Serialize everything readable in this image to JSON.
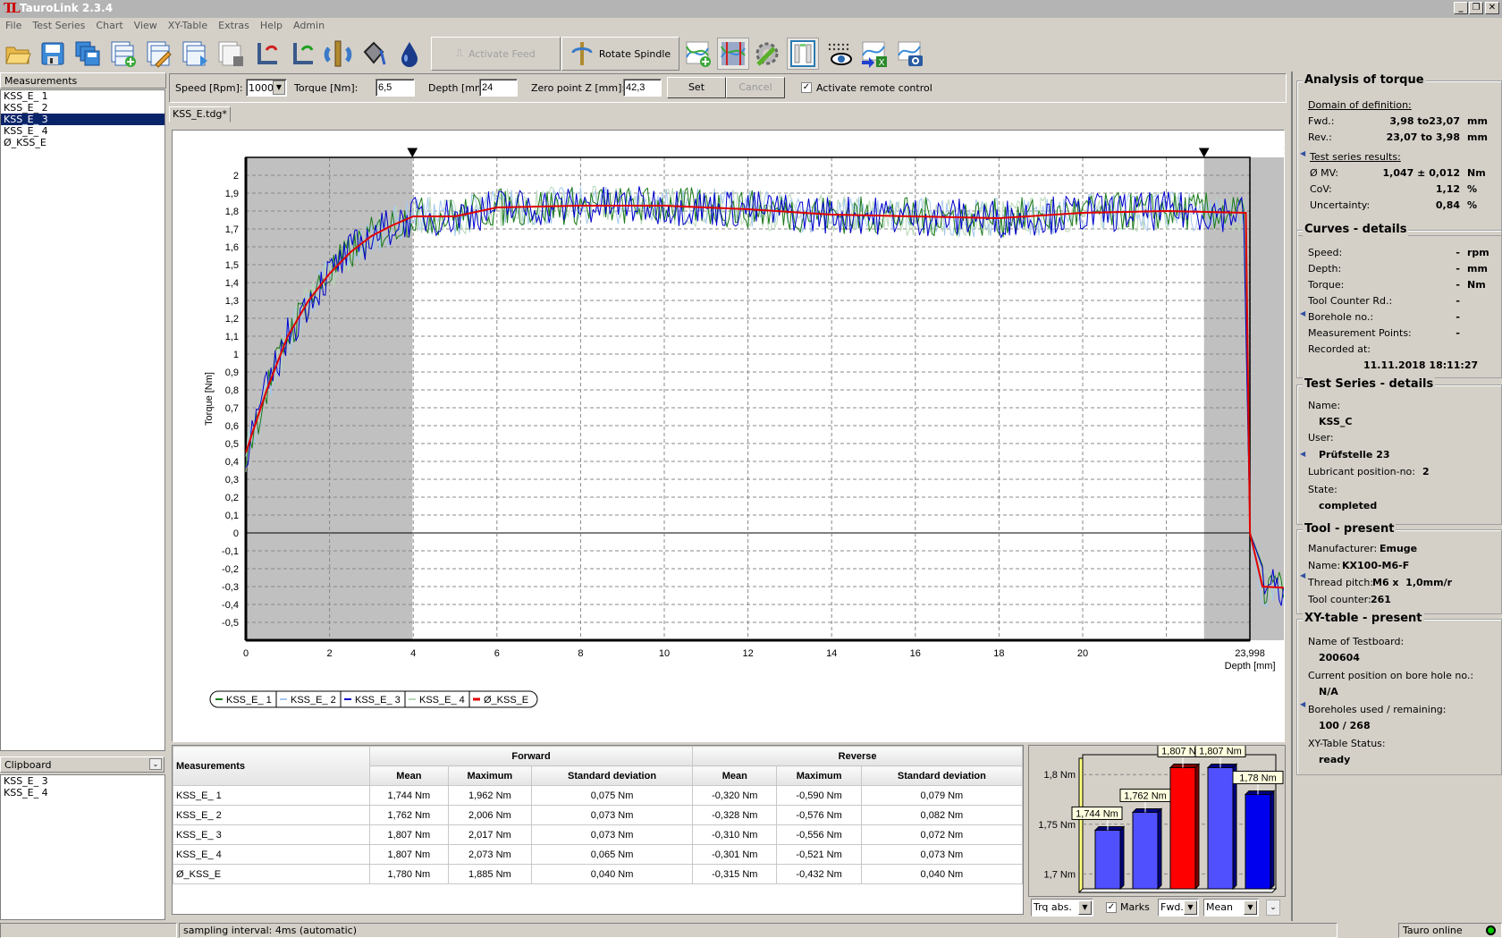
{
  "window": {
    "title": "TauroLink 2.3.4",
    "logo": "TL",
    "controls": [
      "minimize",
      "restore",
      "close"
    ]
  },
  "menu": [
    "File",
    "Test Series",
    "Chart",
    "View",
    "XY-Table",
    "Extras",
    "Help",
    "Admin"
  ],
  "toolbar": {
    "icons": [
      "open-folder-icon",
      "save-icon",
      "save-all-icon",
      "add-table-icon",
      "edit-table-icon",
      "table-play-icon",
      "table-stop-icon",
      "axis-rotate-left-icon",
      "axis-rotate-right-icon",
      "spindle-rotate-icon",
      "oil-can-icon",
      "lubricant-drop-icon"
    ],
    "activate_feed": "Activate Feed",
    "rotate_spindle": "Rotate Spindle",
    "right_icons": [
      "add-chart-icon",
      "chart-markers-icon",
      "settings-tools-icon",
      "layout-panel-icon",
      "view-points-icon",
      "export-excel-icon",
      "chart-snapshot-icon"
    ]
  },
  "left_panel": {
    "measurements_title": "Measurements",
    "measurements": [
      "KSS_E_ 1",
      "KSS_E_ 2",
      "KSS_E_ 3",
      "KSS_E_ 4",
      "Ø_KSS_E"
    ],
    "selected_index": 2,
    "clipboard_title": "Clipboard",
    "clipboard": [
      "KSS_E_ 3",
      "KSS_E_ 4"
    ]
  },
  "settings": {
    "speed_label": "Speed [Rpm]:",
    "speed_value": "1000",
    "torque_label": "Torque [Nm]:",
    "torque_value": "6,5",
    "depth_label": "Depth [mm]",
    "depth_value": "24",
    "zero_label": "Zero point Z [mm]:",
    "zero_value": "42,3",
    "set": "Set",
    "cancel": "Cancel",
    "remote_label": "Activate remote control",
    "remote_checked": true
  },
  "document_tab": "KSS_E.tdg*",
  "chart_data": [
    {
      "type": "line",
      "title": "",
      "xlabel": "Depth [mm]",
      "ylabel": "Torque [Nm]",
      "ylim": [
        -0.6,
        2.1
      ],
      "yticks": [
        "2",
        "1,9",
        "1,8",
        "1,7",
        "1,6",
        "1,5",
        "1,4",
        "1,3",
        "1,2",
        "1,1",
        "1",
        "0,9",
        "0,8",
        "0,7",
        "0,6",
        "0,5",
        "0,4",
        "0,3",
        "0,2",
        "0,1",
        "0",
        "-0,1",
        "-0,2",
        "-0,3",
        "-0,4",
        "-0,5"
      ],
      "xticks_forward": [
        "0",
        "2",
        "4",
        "6",
        "8",
        "10",
        "12",
        "14",
        "16",
        "18",
        "20"
      ],
      "reversal_label": "23,998",
      "xticks_reverse": [
        "20",
        "18",
        "16",
        "14",
        "12",
        "10",
        "8",
        "6",
        "4",
        "2",
        "0"
      ],
      "grid": true,
      "legend": [
        "KSS_E_ 1",
        "KSS_E_ 2",
        "KSS_E_ 3",
        "KSS_E_ 4",
        "Ø_KSS_E"
      ],
      "legend_position": "bottom-left",
      "series_colors": [
        "#1a7a1a",
        "#a6c8ec",
        "#0000cc",
        "#b8d8b8",
        "#e00000"
      ],
      "mean_forward": [
        [
          0,
          0.45
        ],
        [
          0.5,
          0.8
        ],
        [
          1,
          1.1
        ],
        [
          1.5,
          1.3
        ],
        [
          2,
          1.45
        ],
        [
          2.5,
          1.57
        ],
        [
          3,
          1.66
        ],
        [
          3.5,
          1.72
        ],
        [
          4,
          1.77
        ],
        [
          5,
          1.77
        ],
        [
          6,
          1.82
        ],
        [
          8,
          1.83
        ],
        [
          10,
          1.83
        ],
        [
          12,
          1.81
        ],
        [
          14,
          1.78
        ],
        [
          16,
          1.77
        ],
        [
          18,
          1.76
        ],
        [
          20,
          1.79
        ],
        [
          22,
          1.8
        ],
        [
          23.9,
          1.79
        ]
      ],
      "mean_reverse": [
        [
          23.9,
          1.79
        ],
        [
          23.95,
          0.0
        ],
        [
          23.7,
          -0.3
        ],
        [
          22,
          -0.32
        ],
        [
          20,
          -0.32
        ],
        [
          18,
          -0.31
        ],
        [
          16,
          -0.31
        ],
        [
          14,
          -0.32
        ],
        [
          12,
          -0.33
        ],
        [
          10,
          -0.33
        ],
        [
          8,
          -0.34
        ],
        [
          6,
          -0.3
        ],
        [
          4,
          -0.23
        ],
        [
          2,
          -0.18
        ],
        [
          1,
          -0.15
        ],
        [
          0,
          -0.19
        ]
      ],
      "forward_excluded_region": [
        0,
        3.98
      ],
      "reverse_excluded_regions": [
        [
          23.998,
          23.07
        ],
        [
          3.98,
          0
        ]
      ],
      "markers": [
        "start-forward",
        "end-forward",
        "start-reverse",
        "end-reverse"
      ]
    },
    {
      "type": "bar",
      "categories": [
        "KSS_E_ 1",
        "KSS_E_ 2",
        "KSS_E_ 3",
        "KSS_E_ 4",
        "Ø_KSS_E"
      ],
      "values": [
        1.744,
        1.762,
        1.807,
        1.807,
        1.78
      ],
      "data_labels": [
        "1,744 Nm",
        "1,762 Nm",
        "1,807 Nm",
        "1,807 Nm",
        "1,78 Nm"
      ],
      "colors": [
        "#5050ff",
        "#5050ff",
        "#ff0000",
        "#5050ff",
        "#0000ee"
      ],
      "yticks": [
        "1,8 Nm",
        "1,75 Nm",
        "1,7 Nm"
      ],
      "ylim": [
        1.685,
        1.82
      ],
      "grid": true
    }
  ],
  "results": {
    "col_measurements": "Measurements",
    "group_forward": "Forward",
    "group_reverse": "Reverse",
    "cols": [
      "Mean",
      "Maximum",
      "Standard deviation",
      "Mean",
      "Maximum",
      "Standard deviation"
    ],
    "rows": [
      [
        "KSS_E_ 1",
        "1,744 Nm",
        "1,962 Nm",
        "0,075 Nm",
        "-0,320 Nm",
        "-0,590 Nm",
        "0,079 Nm"
      ],
      [
        "KSS_E_ 2",
        "1,762 Nm",
        "2,006 Nm",
        "0,073 Nm",
        "-0,328 Nm",
        "-0,576 Nm",
        "0,082 Nm"
      ],
      [
        "KSS_E_ 3",
        "1,807 Nm",
        "2,017 Nm",
        "0,073 Nm",
        "-0,310 Nm",
        "-0,556 Nm",
        "0,072 Nm"
      ],
      [
        "KSS_E_ 4",
        "1,807 Nm",
        "2,073 Nm",
        "0,065 Nm",
        "-0,301 Nm",
        "-0,521 Nm",
        "0,073 Nm"
      ],
      [
        "Ø_KSS_E",
        "1,780 Nm",
        "1,885 Nm",
        "0,040 Nm",
        "-0,315 Nm",
        "-0,432 Nm",
        "0,040 Nm"
      ]
    ]
  },
  "bar_controls": {
    "mode": "Trq abs.",
    "marks_label": "Marks",
    "marks_checked": true,
    "direction": "Fwd.",
    "statistic": "Mean"
  },
  "analysis": {
    "title": "Analysis of torque",
    "domain_label": "Domain of definition:",
    "fwd_label": "Fwd.:",
    "fwd_value": "3,98 to23,07",
    "fwd_unit": "mm",
    "rev_label": "Rev.:",
    "rev_value": "23,07 to 3,98",
    "rev_unit": "mm",
    "results_label": "Test series results:",
    "mv_label": "Ø MV:",
    "mv_value": "1,047 ± 0,012",
    "mv_unit": "Nm",
    "cov_label": "CoV:",
    "cov_value": "1,12",
    "cov_unit": "%",
    "unc_label": "Uncertainty:",
    "unc_value": "0,84",
    "unc_unit": "%"
  },
  "curves": {
    "title": "Curves - details",
    "speed_label": "Speed:",
    "speed_value": "-",
    "speed_unit": "rpm",
    "depth_label": "Depth:",
    "depth_value": "-",
    "depth_unit": "mm",
    "torque_label": "Torque:",
    "torque_value": "-",
    "torque_unit": "Nm",
    "counter_label": "Tool Counter Rd.:",
    "counter_value": "-",
    "borehole_label": "Borehole no.:",
    "borehole_value": "-",
    "points_label": "Measurement Points:",
    "points_value": "-",
    "recorded_label": "Recorded at:",
    "recorded_value": "11.11.2018 18:11:27"
  },
  "test_series": {
    "title": "Test Series - details",
    "name_label": "Name:",
    "name_value": "KSS_C",
    "user_label": "User:",
    "user_value": "Prüfstelle 23",
    "lub_label": "Lubricant position-no:",
    "lub_value": "2",
    "state_label": "State:",
    "state_value": "completed"
  },
  "tool": {
    "title": "Tool - present",
    "manufacturer_label": "Manufacturer:",
    "manufacturer_value": "Emuge",
    "name_label": "Name:",
    "name_value": "KX100-M6-F",
    "pitch_label": "Thread pitch:",
    "pitch_value": "M6 x  1,0mm/r",
    "counter_label": "Tool counter:",
    "counter_value": "261"
  },
  "xy_table": {
    "title": "XY-table - present",
    "board_label": "Name of Testboard:",
    "board_value": "200604",
    "position_label": "Current position on bore hole no.:",
    "position_value": "N/A",
    "used_label": "Boreholes used / remaining:",
    "used_value": "100 / 268",
    "status_label": "XY-Table Status:",
    "status_value": "ready"
  },
  "statusbar": {
    "sampling": "sampling interval: 4ms (automatic)",
    "connection": "Tauro online",
    "connection_color": "#00cc00"
  }
}
